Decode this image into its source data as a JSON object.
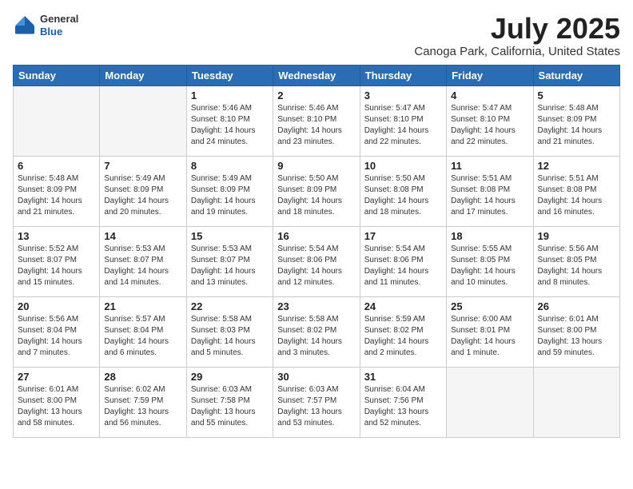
{
  "header": {
    "logo_general": "General",
    "logo_blue": "Blue",
    "month_year": "July 2025",
    "location": "Canoga Park, California, United States"
  },
  "weekdays": [
    "Sunday",
    "Monday",
    "Tuesday",
    "Wednesday",
    "Thursday",
    "Friday",
    "Saturday"
  ],
  "weeks": [
    [
      {
        "day": "",
        "info": ""
      },
      {
        "day": "",
        "info": ""
      },
      {
        "day": "1",
        "info": "Sunrise: 5:46 AM\nSunset: 8:10 PM\nDaylight: 14 hours\nand 24 minutes."
      },
      {
        "day": "2",
        "info": "Sunrise: 5:46 AM\nSunset: 8:10 PM\nDaylight: 14 hours\nand 23 minutes."
      },
      {
        "day": "3",
        "info": "Sunrise: 5:47 AM\nSunset: 8:10 PM\nDaylight: 14 hours\nand 22 minutes."
      },
      {
        "day": "4",
        "info": "Sunrise: 5:47 AM\nSunset: 8:10 PM\nDaylight: 14 hours\nand 22 minutes."
      },
      {
        "day": "5",
        "info": "Sunrise: 5:48 AM\nSunset: 8:09 PM\nDaylight: 14 hours\nand 21 minutes."
      }
    ],
    [
      {
        "day": "6",
        "info": "Sunrise: 5:48 AM\nSunset: 8:09 PM\nDaylight: 14 hours\nand 21 minutes."
      },
      {
        "day": "7",
        "info": "Sunrise: 5:49 AM\nSunset: 8:09 PM\nDaylight: 14 hours\nand 20 minutes."
      },
      {
        "day": "8",
        "info": "Sunrise: 5:49 AM\nSunset: 8:09 PM\nDaylight: 14 hours\nand 19 minutes."
      },
      {
        "day": "9",
        "info": "Sunrise: 5:50 AM\nSunset: 8:09 PM\nDaylight: 14 hours\nand 18 minutes."
      },
      {
        "day": "10",
        "info": "Sunrise: 5:50 AM\nSunset: 8:08 PM\nDaylight: 14 hours\nand 18 minutes."
      },
      {
        "day": "11",
        "info": "Sunrise: 5:51 AM\nSunset: 8:08 PM\nDaylight: 14 hours\nand 17 minutes."
      },
      {
        "day": "12",
        "info": "Sunrise: 5:51 AM\nSunset: 8:08 PM\nDaylight: 14 hours\nand 16 minutes."
      }
    ],
    [
      {
        "day": "13",
        "info": "Sunrise: 5:52 AM\nSunset: 8:07 PM\nDaylight: 14 hours\nand 15 minutes."
      },
      {
        "day": "14",
        "info": "Sunrise: 5:53 AM\nSunset: 8:07 PM\nDaylight: 14 hours\nand 14 minutes."
      },
      {
        "day": "15",
        "info": "Sunrise: 5:53 AM\nSunset: 8:07 PM\nDaylight: 14 hours\nand 13 minutes."
      },
      {
        "day": "16",
        "info": "Sunrise: 5:54 AM\nSunset: 8:06 PM\nDaylight: 14 hours\nand 12 minutes."
      },
      {
        "day": "17",
        "info": "Sunrise: 5:54 AM\nSunset: 8:06 PM\nDaylight: 14 hours\nand 11 minutes."
      },
      {
        "day": "18",
        "info": "Sunrise: 5:55 AM\nSunset: 8:05 PM\nDaylight: 14 hours\nand 10 minutes."
      },
      {
        "day": "19",
        "info": "Sunrise: 5:56 AM\nSunset: 8:05 PM\nDaylight: 14 hours\nand 8 minutes."
      }
    ],
    [
      {
        "day": "20",
        "info": "Sunrise: 5:56 AM\nSunset: 8:04 PM\nDaylight: 14 hours\nand 7 minutes."
      },
      {
        "day": "21",
        "info": "Sunrise: 5:57 AM\nSunset: 8:04 PM\nDaylight: 14 hours\nand 6 minutes."
      },
      {
        "day": "22",
        "info": "Sunrise: 5:58 AM\nSunset: 8:03 PM\nDaylight: 14 hours\nand 5 minutes."
      },
      {
        "day": "23",
        "info": "Sunrise: 5:58 AM\nSunset: 8:02 PM\nDaylight: 14 hours\nand 3 minutes."
      },
      {
        "day": "24",
        "info": "Sunrise: 5:59 AM\nSunset: 8:02 PM\nDaylight: 14 hours\nand 2 minutes."
      },
      {
        "day": "25",
        "info": "Sunrise: 6:00 AM\nSunset: 8:01 PM\nDaylight: 14 hours\nand 1 minute."
      },
      {
        "day": "26",
        "info": "Sunrise: 6:01 AM\nSunset: 8:00 PM\nDaylight: 13 hours\nand 59 minutes."
      }
    ],
    [
      {
        "day": "27",
        "info": "Sunrise: 6:01 AM\nSunset: 8:00 PM\nDaylight: 13 hours\nand 58 minutes."
      },
      {
        "day": "28",
        "info": "Sunrise: 6:02 AM\nSunset: 7:59 PM\nDaylight: 13 hours\nand 56 minutes."
      },
      {
        "day": "29",
        "info": "Sunrise: 6:03 AM\nSunset: 7:58 PM\nDaylight: 13 hours\nand 55 minutes."
      },
      {
        "day": "30",
        "info": "Sunrise: 6:03 AM\nSunset: 7:57 PM\nDaylight: 13 hours\nand 53 minutes."
      },
      {
        "day": "31",
        "info": "Sunrise: 6:04 AM\nSunset: 7:56 PM\nDaylight: 13 hours\nand 52 minutes."
      },
      {
        "day": "",
        "info": ""
      },
      {
        "day": "",
        "info": ""
      }
    ]
  ]
}
